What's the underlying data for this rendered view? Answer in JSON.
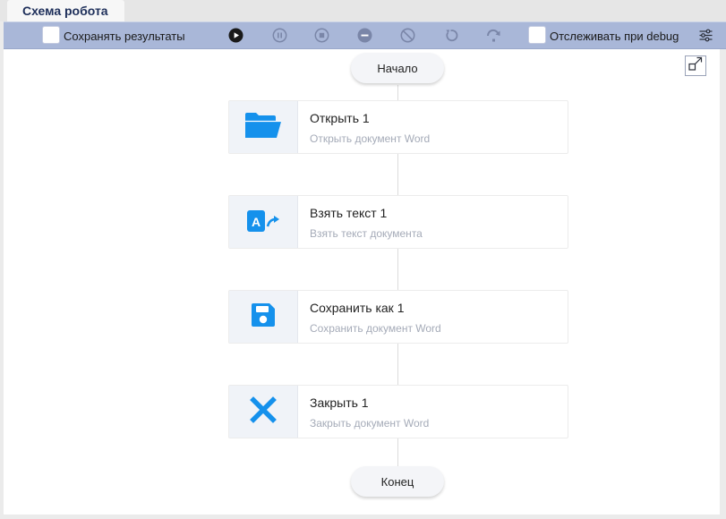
{
  "tab": {
    "title": "Схема робота"
  },
  "toolbar": {
    "save_results_label": "Сохранять результаты",
    "debug_track_label": "Отслеживать при debug",
    "icons": [
      "play-icon",
      "pause-icon",
      "stop-icon",
      "minus-circle-icon",
      "block-icon",
      "undo-icon",
      "redo-icon",
      "settings-sliders-icon"
    ]
  },
  "flow": {
    "start_label": "Начало",
    "end_label": "Конец",
    "blocks": [
      {
        "title": "Открыть  1",
        "subtitle": "Открыть документ Word",
        "icon": "folder-open-icon"
      },
      {
        "title": "Взять текст  1",
        "subtitle": "Взять текст документа",
        "icon": "take-text-icon"
      },
      {
        "title": "Сохранить как  1",
        "subtitle": "Сохранить документ Word",
        "icon": "save-icon"
      },
      {
        "title": "Закрыть  1",
        "subtitle": "Закрыть документ Word",
        "icon": "close-icon"
      }
    ]
  },
  "colors": {
    "toolbar_bg": "#a9b7d8",
    "accent": "#1591ec",
    "tab_text": "#1e2f5a"
  }
}
